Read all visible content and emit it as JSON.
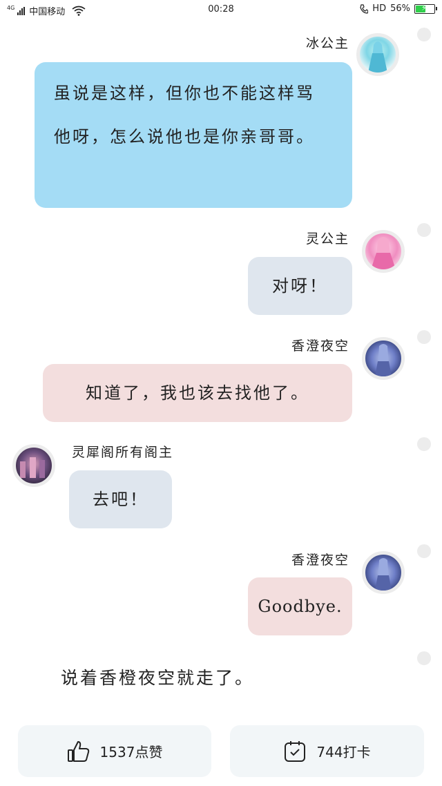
{
  "status_bar": {
    "network": "4G",
    "carrier": "中国移动",
    "time": "00:28",
    "hd": "HD",
    "battery": "56%",
    "battery_level": 0.56,
    "battery_color": "#2fcf4a"
  },
  "messages": [
    {
      "name": "冰公主",
      "text": "虽说是这样，但你也不能这样骂他呀，怎么说他也是你亲哥哥。"
    },
    {
      "name": "灵公主",
      "text": "对呀！"
    },
    {
      "name": "香澄夜空",
      "text": "知道了，我也该去找他了。"
    },
    {
      "name": "灵犀阁所有阁主",
      "text": "去吧！"
    },
    {
      "name": "香澄夜空",
      "text": "Goodbye."
    }
  ],
  "narration": "说着香橙夜空就走了。",
  "actions": {
    "like_label": "1537点赞",
    "checkin_label": "744打卡"
  },
  "colors": {
    "bubble_blue": "#a4dcf5",
    "bubble_gray": "#dfe6ee",
    "bubble_pink": "#f3dede",
    "action_bg": "#f2f6f8"
  }
}
